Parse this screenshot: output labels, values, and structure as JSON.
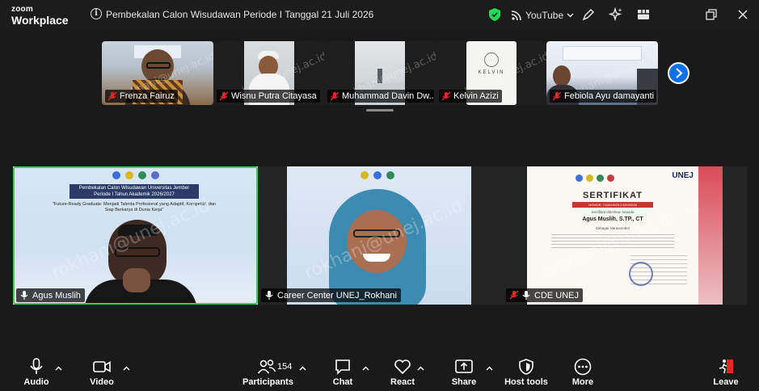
{
  "app": {
    "logo_top": "zoom",
    "logo_bottom": "Workplace"
  },
  "meeting": {
    "title": "Pembekalan Calon Wisudawan Periode I Tanggal 21 Juli 2026",
    "live_label": "YouTube"
  },
  "thumbnails": [
    {
      "name": "Frenza Fairuz",
      "muted": true
    },
    {
      "name": "Wisnu Putra Citayasa",
      "muted": true
    },
    {
      "name": "Muhammad Davin Dw...",
      "muted": true
    },
    {
      "name": "Kelvin Azizi",
      "muted": true
    },
    {
      "name": "Febiola Ayu damayanti",
      "muted": true
    }
  ],
  "tiles": [
    {
      "name": "Agus Muslih",
      "active_speaker": true,
      "watermark": "rokhani@unej.ac.id"
    },
    {
      "name": "Career Center UNEJ_Rokhani",
      "active_speaker": false,
      "watermark": "rokhani@unej.ac.id"
    },
    {
      "name": "CDE UNEJ",
      "active_speaker": false,
      "watermark": "rokhani@unej.ac.id"
    }
  ],
  "thumb_watermark": "rokhani@unej.ac.id",
  "thumb_logo_text": "KELVIN",
  "slide": {
    "header": "Pembekalan Calon Wisudawan Universitas Jember Periode I Tahun Akademik 2026/2027",
    "tagline": "\"Future-Ready Graduate: Menjadi Talenta Profesional yang Adaptif, Kompetitif, dan Siap Berkarya di Dunia Kerja\""
  },
  "certificate": {
    "brand": "UNEJ",
    "title": "SERTIFIKAT",
    "number_label": "NOMOR: 7128/UN25.3.5/DI/2026",
    "given_to": "Sertifikat diberikan kepada",
    "recipient": "Agus Muslih, S.TP., CT",
    "role": "Sebagai Narasumber"
  },
  "toolbar": {
    "audio": "Audio",
    "video": "Video",
    "participants": "Participants",
    "participant_count": "154",
    "chat": "Chat",
    "react": "React",
    "share": "Share",
    "host_tools": "Host tools",
    "more": "More",
    "leave": "Leave"
  },
  "colors": {
    "accent": "#0e71eb",
    "active_speaker": "#23d959",
    "leave": "#e02828",
    "secure": "#23d959"
  }
}
